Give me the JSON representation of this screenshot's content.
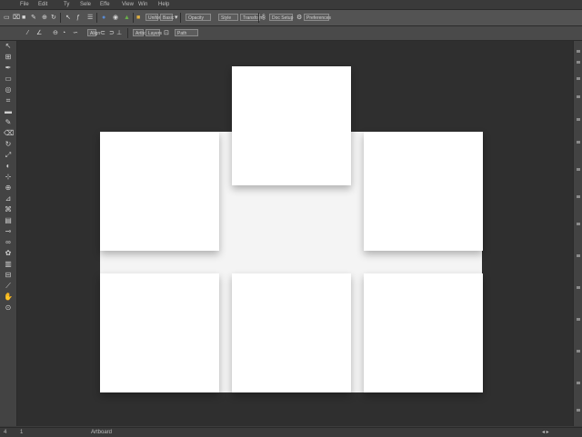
{
  "menu": {
    "items": [
      "File",
      "Edit",
      "Ty",
      "Sele",
      "Effe",
      "View",
      "Win",
      "Help"
    ]
  },
  "toolbar": {
    "groups": [
      "Shape",
      "Stroke",
      "Opacity",
      "Style",
      "Doc Setup",
      "Preferences"
    ],
    "fields": [
      "Uniform",
      "Basic",
      "Transform"
    ]
  },
  "control_bar": {
    "items": [
      "Align",
      "Path",
      "Artboards",
      "Layers"
    ]
  },
  "tools": [
    "selection-tool",
    "direct-selection-tool",
    "pen-tool",
    "type-tool",
    "line-tool",
    "rectangle-tool",
    "paintbrush-tool",
    "pencil-tool",
    "eraser-tool",
    "rotate-tool",
    "scale-tool",
    "width-tool",
    "free-transform-tool",
    "shape-builder-tool",
    "perspective-tool",
    "mesh-tool",
    "gradient-tool",
    "eyedropper-tool",
    "blend-tool",
    "symbol-sprayer-tool",
    "column-graph-tool",
    "artboard-tool",
    "slice-tool",
    "hand-tool",
    "zoom-tool"
  ],
  "status": {
    "zoom": "4",
    "page": "1",
    "info": "Artboard"
  },
  "colors": {
    "chrome": "#535353",
    "canvas": "#2f2f2f",
    "artboard": "#ffffff"
  }
}
